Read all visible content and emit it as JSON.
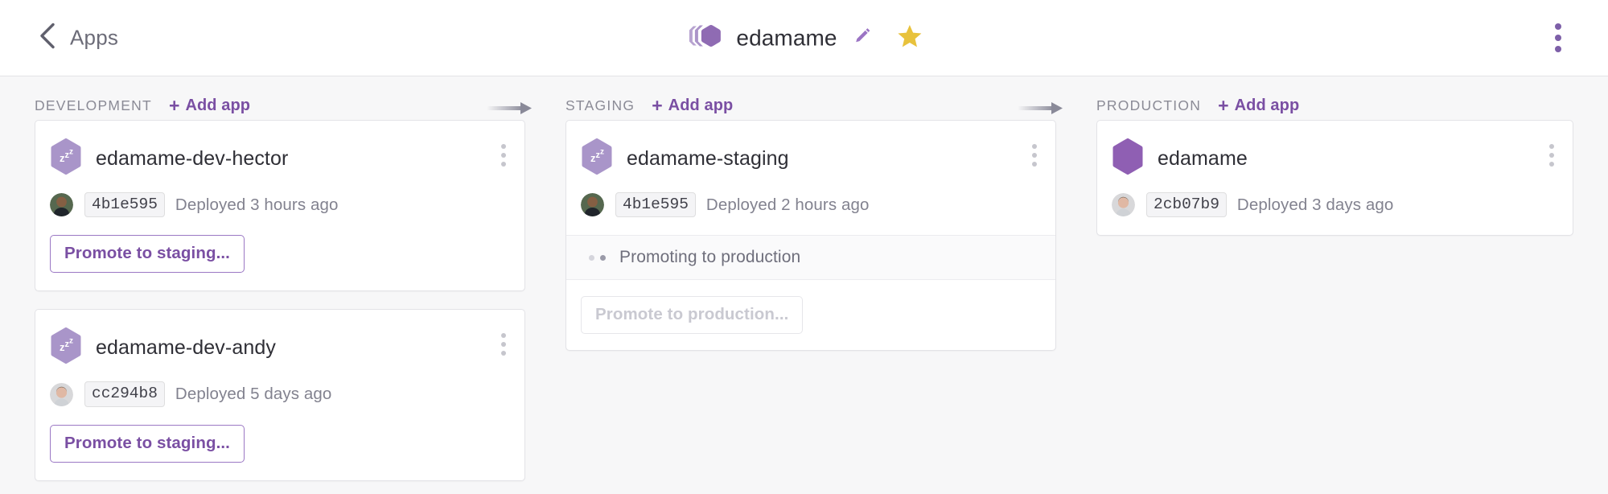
{
  "header": {
    "back_label": "Apps",
    "back_icon": "chevron-left-icon",
    "pipeline_icon": "pipeline-hexagons-icon",
    "title": "edamame",
    "edit_icon": "pencil-icon",
    "favorite_icon": "star-icon",
    "overflow_icon": "kebab-menu-icon"
  },
  "colors": {
    "accent": "#7a4fa3",
    "accent_light": "#a995c9",
    "star": "#e8c23c",
    "muted": "#82828f",
    "page_bg": "#f7f7f8"
  },
  "columns": [
    {
      "name": "DEVELOPMENT",
      "add_app_plus": "+",
      "add_app_label": "Add app",
      "arrow": "arrow-right-icon",
      "apps": [
        {
          "status_icon": "sleeping-hexagon-icon",
          "name": "edamame-dev-hector",
          "overflow_icon": "kebab-menu-icon",
          "avatar": "user-avatar",
          "sha": "4b1e595",
          "deployed": "Deployed 3 hours ago",
          "promote_label": "Promote to staging...",
          "promote_disabled": false
        },
        {
          "status_icon": "sleeping-hexagon-icon",
          "name": "edamame-dev-andy",
          "overflow_icon": "kebab-menu-icon",
          "avatar": "user-avatar",
          "sha": "cc294b8",
          "deployed": "Deployed 5 days ago",
          "promote_label": "Promote to staging...",
          "promote_disabled": false
        }
      ]
    },
    {
      "name": "STAGING",
      "add_app_plus": "+",
      "add_app_label": "Add app",
      "arrow": "arrow-right-icon",
      "apps": [
        {
          "status_icon": "sleeping-hexagon-icon",
          "name": "edamame-staging",
          "overflow_icon": "kebab-menu-icon",
          "avatar": "user-avatar",
          "sha": "4b1e595",
          "deployed": "Deployed 2 hours ago",
          "activity": "Promoting to production",
          "activity_icon": "loading-dots-icon",
          "promote_label": "Promote to production...",
          "promote_disabled": true
        }
      ]
    },
    {
      "name": "PRODUCTION",
      "add_app_plus": "+",
      "add_app_label": "Add app",
      "arrow": null,
      "apps": [
        {
          "status_icon": "active-hexagon-icon",
          "name": "edamame",
          "overflow_icon": "kebab-menu-icon",
          "avatar": "user-avatar",
          "sha": "2cb07b9",
          "deployed": "Deployed 3 days ago"
        }
      ]
    }
  ]
}
